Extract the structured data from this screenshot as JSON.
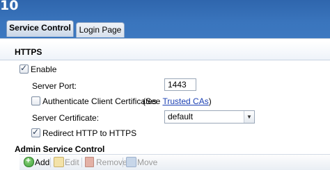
{
  "window": {
    "number": "10"
  },
  "tabs": [
    {
      "label": "Service Control",
      "active": true
    },
    {
      "label": "Login Page",
      "active": false
    }
  ],
  "https": {
    "section_title": "HTTPS",
    "enable_label": "Enable",
    "enable_checked": true,
    "server_port_label": "Server Port:",
    "server_port_value": "1443",
    "auth_client_certs_label": "Authenticate Client Certificates",
    "auth_client_certs_checked": false,
    "see_prefix": "(See ",
    "trusted_cas_link": "Trusted CAs",
    "see_suffix": ")",
    "server_certificate_label": "Server Certificate:",
    "server_certificate_value": "default",
    "redirect_label": "Redirect HTTP to HTTPS",
    "redirect_checked": true
  },
  "admin": {
    "section_title": "Admin Service Control",
    "toolbar": {
      "add_label": "Add",
      "edit_label": "Edit",
      "remove_label": "Remove",
      "move_label": "Move"
    }
  },
  "icons": {
    "add": "plus-circle-icon",
    "edit": "pencil-icon",
    "remove": "trash-icon",
    "move": "move-arrows-icon"
  },
  "colors": {
    "topbar": "#3a75bd",
    "link": "#1a3fb3",
    "add_icon": "#3fa33a"
  }
}
